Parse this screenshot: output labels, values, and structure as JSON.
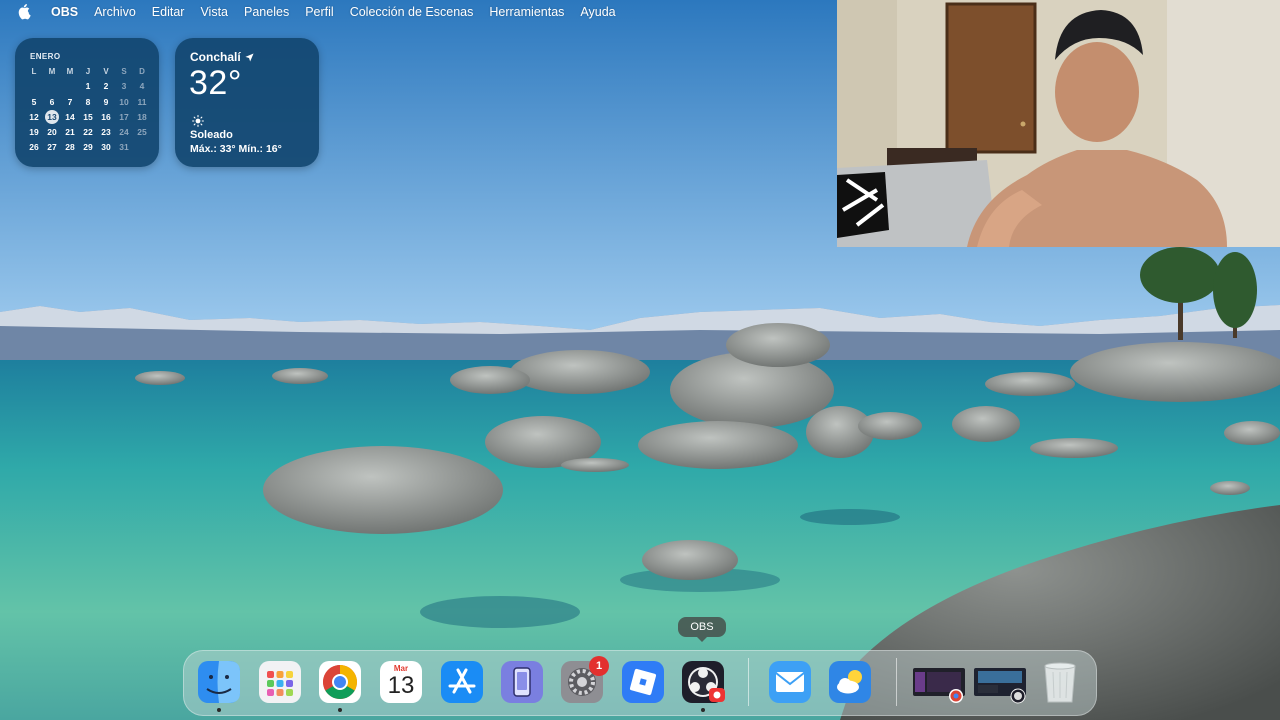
{
  "menubar": {
    "app_name": "OBS",
    "items": [
      "Archivo",
      "Editar",
      "Vista",
      "Paneles",
      "Perfil",
      "Colección de Escenas",
      "Herramientas",
      "Ayuda"
    ]
  },
  "calendar_widget": {
    "month": "ENERO",
    "weekdays": [
      "L",
      "M",
      "M",
      "J",
      "V",
      "S",
      "D"
    ],
    "weeks": [
      [
        "",
        "",
        "",
        "1",
        "2",
        "3",
        "4"
      ],
      [
        "5",
        "6",
        "7",
        "8",
        "9",
        "10",
        "11"
      ],
      [
        "12",
        "13",
        "14",
        "15",
        "16",
        "17",
        "18"
      ],
      [
        "19",
        "20",
        "21",
        "22",
        "23",
        "24",
        "25"
      ],
      [
        "26",
        "27",
        "28",
        "29",
        "30",
        "31",
        ""
      ]
    ],
    "today": "13"
  },
  "weather_widget": {
    "location": "Conchalí",
    "temperature": "32°",
    "condition": "Soleado",
    "range": "Máx.: 33° Mín.: 16°",
    "icon": "sun-icon"
  },
  "dock": {
    "tooltip": "OBS",
    "apps": [
      {
        "name": "finder",
        "icon": "finder-icon",
        "running": true
      },
      {
        "name": "launchpad",
        "icon": "launchpad-icon",
        "running": false
      },
      {
        "name": "chrome",
        "icon": "chrome-icon",
        "running": true
      },
      {
        "name": "calendar",
        "icon": "calendar-icon",
        "running": false,
        "month": "Mar",
        "day": "13"
      },
      {
        "name": "app-store",
        "icon": "app-store-icon",
        "running": false
      },
      {
        "name": "iphone-mirroring",
        "icon": "iphone-mirroring-icon",
        "running": false
      },
      {
        "name": "system-settings",
        "icon": "gear-icon",
        "running": false,
        "badge": "1"
      },
      {
        "name": "roblox",
        "icon": "roblox-icon",
        "running": false
      },
      {
        "name": "obs",
        "icon": "obs-icon",
        "running": true
      },
      {
        "name": "mail",
        "icon": "mail-icon",
        "running": false
      },
      {
        "name": "weather",
        "icon": "weather-icon",
        "running": false
      },
      {
        "name": "chrome-window",
        "icon": "window-thumbnail-icon",
        "running": false
      },
      {
        "name": "obs-window",
        "icon": "window-thumbnail-icon",
        "running": false
      },
      {
        "name": "trash",
        "icon": "trash-icon",
        "running": false
      }
    ]
  },
  "colors": {
    "sky_top": "#2f7fc3",
    "sky_bottom": "#8cc0e8",
    "water": "#2ba7a8",
    "widget_bg": "#124670",
    "badge": "#e3302f"
  }
}
